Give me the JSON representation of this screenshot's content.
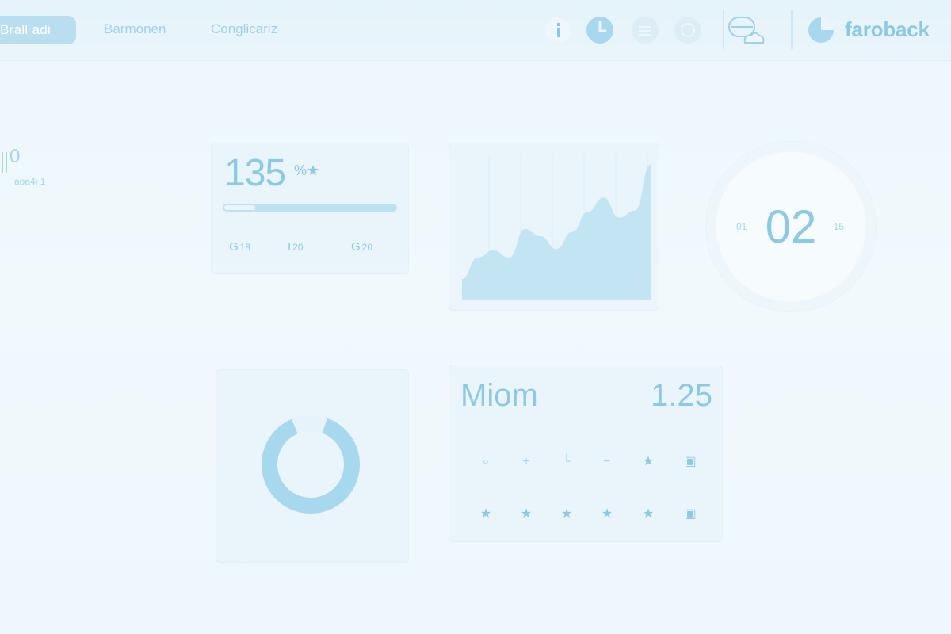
{
  "nav": {
    "tabs": [
      {
        "label": "Brall adi",
        "active": true
      },
      {
        "label": "Barmonen"
      },
      {
        "label": "Conglicariz"
      }
    ]
  },
  "toolbar_icons": [
    "info-icon",
    "clock-icon",
    "list-icon",
    "globe-icon",
    "cloud-monitor-icon"
  ],
  "brand": {
    "name": "faroback",
    "icon": "pie-logo-icon"
  },
  "side_stat": {
    "value": "0",
    "sub": "aoa4i 1"
  },
  "card_count": {
    "value": "135",
    "tag": "%★",
    "progress": 0.18,
    "stats": [
      {
        "icon": "G",
        "value": "18"
      },
      {
        "icon": "I",
        "value": "20"
      },
      {
        "icon": "G",
        "value": "20"
      }
    ]
  },
  "gauge": {
    "value": "02",
    "left_label": "01",
    "right_label": "15"
  },
  "metric": {
    "title": "Miom",
    "value": "1.25",
    "row1_icons": [
      "search-icon",
      "plus-icon",
      "chart-icon",
      "minus-icon",
      "star-icon",
      "square-icon"
    ],
    "row2_icons": [
      "star-icon",
      "star-icon",
      "star-icon",
      "star-icon",
      "star-icon",
      "square-icon"
    ]
  },
  "area_chart": {
    "values": [
      0.15,
      0.3,
      0.35,
      0.3,
      0.5,
      0.45,
      0.36,
      0.48,
      0.62,
      0.72,
      0.58,
      0.63,
      0.95
    ]
  },
  "donut": {
    "fraction": 0.88
  },
  "colors": {
    "accent": "#8cc9e2",
    "light": "#bfe2f2",
    "bg": "#eef7fc"
  }
}
